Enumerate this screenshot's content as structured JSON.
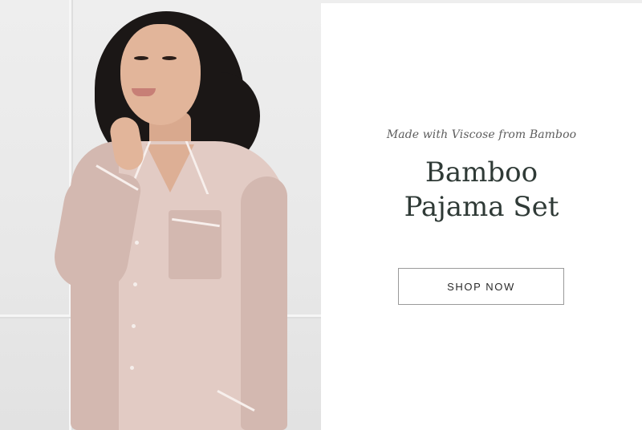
{
  "hero": {
    "image_alt": "Woman wearing a blush pink long-sleeve bamboo pajama shirt"
  },
  "promo": {
    "eyebrow": "Made with Viscose from Bamboo",
    "title_line1": "Bamboo",
    "title_line2": "Pajama Set",
    "cta_label": "SHOP NOW"
  },
  "colors": {
    "title": "#2f3a36",
    "eyebrow": "#5d5d5d",
    "cta_border": "#9a9a9a",
    "shirt": "#e2cbc4"
  }
}
